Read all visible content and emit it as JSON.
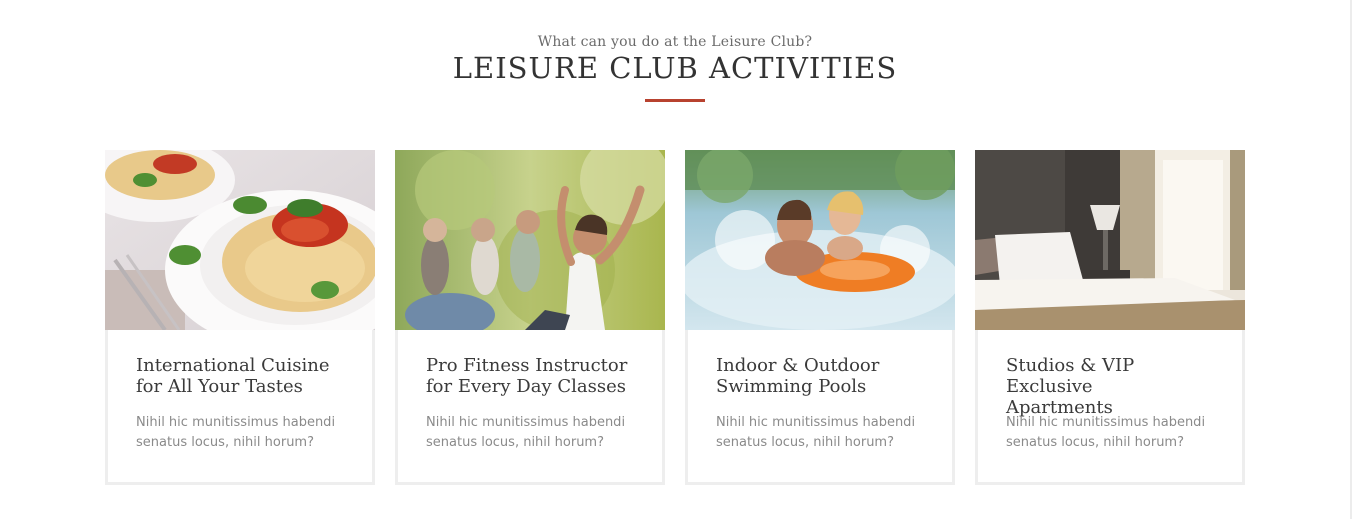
{
  "section": {
    "subtitle": "What can you do at the Leisure Club?",
    "title": "LEISURE CLUB ACTIVITIES",
    "accent_color": "#b8422f"
  },
  "cards": [
    {
      "image": "pasta-photo",
      "title_line1": "International Cuisine",
      "title_line2": "for All Your Tastes",
      "text_line1": "Nihil hic munitissimus habendi",
      "text_line2": "senatus locus, nihil horum?"
    },
    {
      "image": "fitness-photo",
      "title_line1": "Pro Fitness Instructor",
      "title_line2": "for Every Day Classes",
      "text_line1": "Nihil hic munitissimus habendi",
      "text_line2": "senatus locus, nihil horum?"
    },
    {
      "image": "swimming-pool-photo",
      "title_line1": "Indoor & Outdoor",
      "title_line2": "Swimming Pools",
      "text_line1": "Nihil hic munitissimus habendi",
      "text_line2": "senatus locus, nihil horum?"
    },
    {
      "image": "apartment-bedroom-photo",
      "title_line1": "Studios & VIP Exclusive",
      "title_line2": "Apartments",
      "text_line1": "Nihil hic munitissimus habendi",
      "text_line2": "senatus locus, nihil horum?"
    }
  ]
}
